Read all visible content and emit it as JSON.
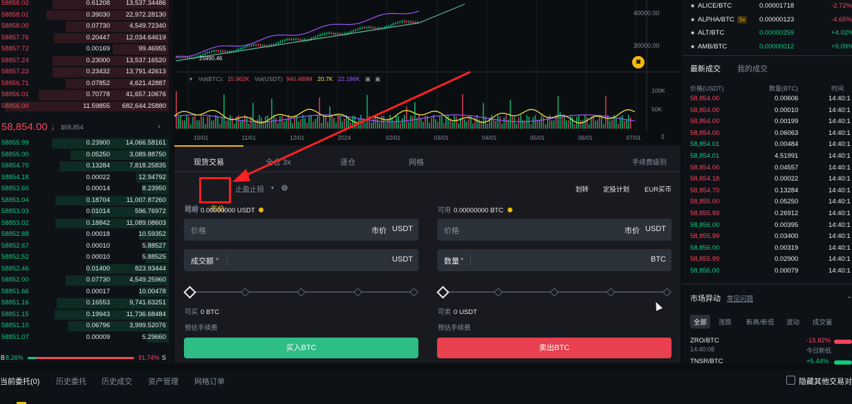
{
  "order_book": {
    "asks": [
      {
        "price": "58858.02",
        "qty": "0.61208",
        "total": "13,537.34486"
      },
      {
        "price": "58858.01",
        "qty": "0.39030",
        "total": "22,972.28130"
      },
      {
        "price": "58858.00",
        "qty": "0.07730",
        "total": "4,549.72340"
      },
      {
        "price": "58857.76",
        "qty": "0.20447",
        "total": "12,034.64619"
      },
      {
        "price": "58857.72",
        "qty": "0.00169",
        "total": "99.46955"
      },
      {
        "price": "58857.24",
        "qty": "0.23000",
        "total": "13,537.16520"
      },
      {
        "price": "58857.23",
        "qty": "0.23432",
        "total": "13,791.42613"
      },
      {
        "price": "58856.71",
        "qty": "0.07852",
        "total": "4,621.42887"
      },
      {
        "price": "58856.01",
        "qty": "0.70778",
        "total": "41,657.10676"
      },
      {
        "price": "58856.00",
        "qty": "11.59855",
        "total": "682,644.25880"
      }
    ],
    "last_price": "58,854.00",
    "last_price_arrow": "↓",
    "last_price_usd": "$58,854",
    "more_icon": "chevron-right-icon",
    "bids": [
      {
        "price": "58855.99",
        "qty": "0.23900",
        "total": "14,066.58161"
      },
      {
        "price": "58855.00",
        "qty": "0.05250",
        "total": "3,089.88750"
      },
      {
        "price": "58854.70",
        "qty": "0.13284",
        "total": "7,818.25835"
      },
      {
        "price": "58854.18",
        "qty": "0.00022",
        "total": "12.94792"
      },
      {
        "price": "58853.60",
        "qty": "0.00014",
        "total": "8.23950"
      },
      {
        "price": "58853.04",
        "qty": "0.18704",
        "total": "11,007.87260"
      },
      {
        "price": "58853.03",
        "qty": "0.01014",
        "total": "596.76972"
      },
      {
        "price": "58853.02",
        "qty": "0.18842",
        "total": "11,089.08603"
      },
      {
        "price": "58852.88",
        "qty": "0.00018",
        "total": "10.59352"
      },
      {
        "price": "58852.67",
        "qty": "0.00010",
        "total": "5.88527"
      },
      {
        "price": "58852.52",
        "qty": "0.00010",
        "total": "5.88525"
      },
      {
        "price": "58852.46",
        "qty": "0.01400",
        "total": "823.93444"
      },
      {
        "price": "58852.00",
        "qty": "0.07730",
        "total": "4,549.25960"
      },
      {
        "price": "58851.66",
        "qty": "0.00017",
        "total": "10.00478"
      },
      {
        "price": "58851.16",
        "qty": "0.16553",
        "total": "9,741.63251"
      },
      {
        "price": "58851.15",
        "qty": "0.19943",
        "total": "11,736.68484"
      },
      {
        "price": "58851.10",
        "qty": "0.06796",
        "total": "3,999.52076"
      },
      {
        "price": "58851.07",
        "qty": "0.00009",
        "total": "5.29660"
      }
    ],
    "ratio_buy_label": "B",
    "ratio_buy": "8.26%",
    "ratio_sell": "91.74%",
    "ratio_sell_label": "S",
    "ratio_buy_fraction": 0.0826
  },
  "chart": {
    "y_ticks": [
      "40000.00",
      "30000.00"
    ],
    "low_label": "25990.46",
    "volume_legend": {
      "vol_btc_label": "Vol(BTC):",
      "vol_btc": "15.962K",
      "vol_usdt_label": "Vol(USDT)",
      "vol_usdt": "940.489M",
      "ma5": "20.7K",
      "ma10": "22.186K"
    },
    "vol_ticks": [
      "100K",
      "50K"
    ],
    "x_ticks": [
      "10/01",
      "11/01",
      "12/01",
      "2024",
      "02/01",
      "03/01",
      "04/01",
      "05/01",
      "06/01",
      "07/01"
    ],
    "colors": {
      "up": "#0ecb81",
      "down": "#f6465d",
      "ma_yellow": "#f0e442",
      "ma_purple": "#9b59ff",
      "ma_green": "#5fb89a"
    }
  },
  "trade": {
    "tabs": [
      "现货交易",
      "全仓 3x",
      "逐仓",
      "网格"
    ],
    "fee_level": "手续费级别",
    "order_types": {
      "limit": "限价",
      "market": "市价",
      "stop": "止盈止损"
    },
    "links": [
      "划转",
      "定投计划",
      "EUR买币"
    ],
    "buy": {
      "avail_label": "可用",
      "avail_value": "0.00000000 USDT",
      "price_label": "价格",
      "price_value": "市价",
      "price_unit": "USDT",
      "amount_label": "成交额",
      "amount_unit": "USDT",
      "can_label": "可买",
      "can_value": "0 BTC",
      "fee_label": "预估手续费",
      "button": "买入BTC"
    },
    "sell": {
      "avail_label": "可用",
      "avail_value": "0.00000000 BTC",
      "price_label": "价格",
      "price_value": "市价",
      "price_unit": "USDT",
      "amount_label": "数量",
      "amount_unit": "BTC",
      "can_label": "可卖",
      "can_value": "0 USDT",
      "fee_label": "预估手续费",
      "button": "卖出BTC"
    }
  },
  "markets": [
    {
      "pair": "ALICE/BTC",
      "badge": "",
      "price": "0.00001718",
      "change": "-2.72%",
      "dir": "down"
    },
    {
      "pair": "ALPHA/BTC",
      "badge": "5x",
      "price": "0.00000123",
      "change": "-4.65%",
      "dir": "down"
    },
    {
      "pair": "ALT/BTC",
      "badge": "",
      "price": "0.00000259",
      "change": "+4.02%",
      "dir": "up"
    },
    {
      "pair": "AMB/BTC",
      "badge": "",
      "price": "0.00000012",
      "change": "+9.09%",
      "dir": "up"
    }
  ],
  "trades": {
    "tabs": [
      "最新成交",
      "我的成交"
    ],
    "headers": [
      "价格(USDT)",
      "数量(BTC)",
      "时间"
    ],
    "rows": [
      {
        "price": "58,854.00",
        "qty": "0.00606",
        "time": "14:40:1",
        "dir": "down"
      },
      {
        "price": "58,854.00",
        "qty": "0.00010",
        "time": "14:40:1",
        "dir": "down"
      },
      {
        "price": "58,854.00",
        "qty": "0.00199",
        "time": "14:40:1",
        "dir": "down"
      },
      {
        "price": "58,854.00",
        "qty": "0.06063",
        "time": "14:40:1",
        "dir": "down"
      },
      {
        "price": "58,854.01",
        "qty": "0.00484",
        "time": "14:40:1",
        "dir": "up"
      },
      {
        "price": "58,854.01",
        "qty": "4.51991",
        "time": "14:40:1",
        "dir": "up"
      },
      {
        "price": "58,854.00",
        "qty": "0.04557",
        "time": "14:40:1",
        "dir": "down"
      },
      {
        "price": "58,854.18",
        "qty": "0.00022",
        "time": "14:40:1",
        "dir": "down"
      },
      {
        "price": "58,854.70",
        "qty": "0.13284",
        "time": "14:40:1",
        "dir": "down"
      },
      {
        "price": "58,855.00",
        "qty": "0.05250",
        "time": "14:40:1",
        "dir": "down"
      },
      {
        "price": "58,855.99",
        "qty": "0.26912",
        "time": "14:40:1",
        "dir": "down"
      },
      {
        "price": "58,856.00",
        "qty": "0.00395",
        "time": "14:40:1",
        "dir": "up"
      },
      {
        "price": "58,855.99",
        "qty": "0.03400",
        "time": "14:40:1",
        "dir": "down"
      },
      {
        "price": "58,856.00",
        "qty": "0.00319",
        "time": "14:40:1",
        "dir": "up"
      },
      {
        "price": "58,855.99",
        "qty": "0.02900",
        "time": "14:40:1",
        "dir": "down"
      },
      {
        "price": "58,856.00",
        "qty": "0.00079",
        "time": "14:40:1",
        "dir": "up"
      }
    ]
  },
  "movers": {
    "title": "市场异动",
    "faq": "常见问题",
    "filters": [
      "全部",
      "涨跌",
      "新高/新低",
      "波动",
      "成交量"
    ],
    "items": [
      {
        "pair": "ZRO/BTC",
        "time": "14:40:08",
        "change": "-15.82%",
        "note": "今日新低",
        "dir": "down"
      },
      {
        "pair": "TNSR/BTC",
        "time": "",
        "change": "+5.44%",
        "note": "",
        "dir": "up"
      }
    ]
  },
  "bottom": {
    "tabs": [
      "当前委托(0)",
      "历史委托",
      "历史成交",
      "资产管理",
      "网格订单"
    ],
    "hide_label": "隐藏其他交易对"
  }
}
